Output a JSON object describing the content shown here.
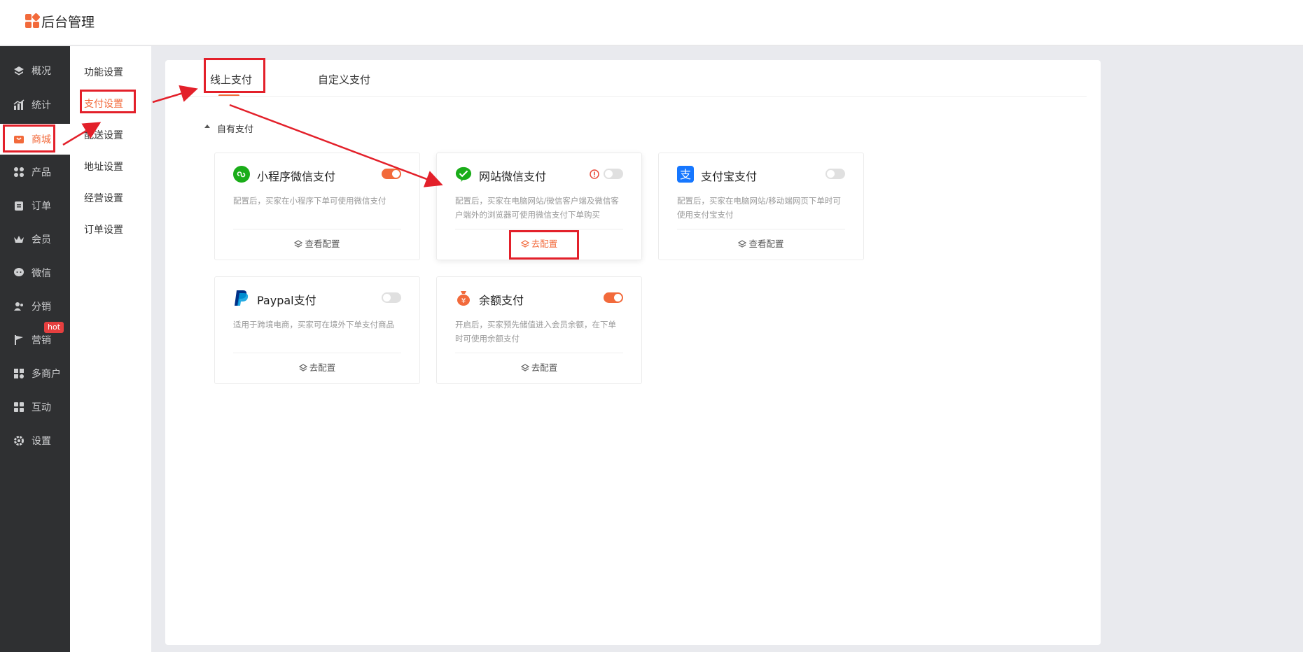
{
  "app": {
    "title": "后台管理"
  },
  "sidebar": {
    "items": [
      {
        "label": "概况",
        "icon": "layers-icon"
      },
      {
        "label": "统计",
        "icon": "chart-icon"
      },
      {
        "label": "商城",
        "icon": "shop-icon",
        "active": true
      },
      {
        "label": "产品",
        "icon": "grid-icon"
      },
      {
        "label": "订单",
        "icon": "clipboard-icon"
      },
      {
        "label": "会员",
        "icon": "crown-icon"
      },
      {
        "label": "微信",
        "icon": "chat-icon"
      },
      {
        "label": "分销",
        "icon": "users-icon"
      },
      {
        "label": "营销",
        "icon": "flag-icon",
        "badge": "hot"
      },
      {
        "label": "多商户",
        "icon": "store-icon"
      },
      {
        "label": "互动",
        "icon": "apps-icon"
      },
      {
        "label": "设置",
        "icon": "gear-icon"
      }
    ]
  },
  "submenu": {
    "items": [
      {
        "label": "功能设置"
      },
      {
        "label": "支付设置",
        "active": true
      },
      {
        "label": "配送设置"
      },
      {
        "label": "地址设置"
      },
      {
        "label": "经营设置"
      },
      {
        "label": "订单设置"
      }
    ]
  },
  "tabs": [
    {
      "label": "线上支付",
      "active": true
    },
    {
      "label": "自定义支付"
    }
  ],
  "section": {
    "title": "自有支付"
  },
  "payments": [
    {
      "name": "小程序微信支付",
      "desc": "配置后，买家在小程序下单可使用微信支付",
      "action": "查看配置",
      "enabled": true,
      "icon": "miniprogram-icon"
    },
    {
      "name": "网站微信支付",
      "desc": "配置后，买家在电脑网站/微信客户端及微信客户端外的浏览器可使用微信支付下单购买",
      "action": "去配置",
      "enabled": false,
      "warning": true,
      "icon": "wechat-icon"
    },
    {
      "name": "支付宝支付",
      "desc": "配置后，买家在电脑网站/移动端网页下单时可使用支付宝支付",
      "action": "查看配置",
      "enabled": false,
      "icon": "alipay-icon"
    },
    {
      "name": "Paypal支付",
      "desc": "适用于跨境电商，买家可在境外下单支付商品",
      "action": "去配置",
      "enabled": false,
      "icon": "paypal-icon"
    },
    {
      "name": "余额支付",
      "desc": "开启后，买家预先储值进入会员余额，在下单时可使用余额支付",
      "action": "去配置",
      "enabled": true,
      "icon": "moneybag-icon"
    }
  ],
  "colors": {
    "accent": "#f26a3b",
    "sidebar_bg": "#2f3032",
    "annotation": "#e3202a",
    "wechat": "#1aad19",
    "alipay": "#1677ff",
    "paypal": "#003087"
  }
}
